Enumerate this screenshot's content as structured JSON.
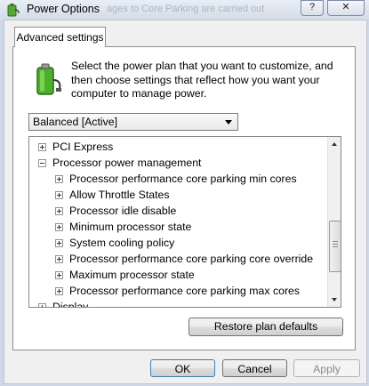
{
  "window": {
    "title": "Power Options",
    "background_caption": "ages to Core Parking are carried out",
    "help_label": "?",
    "close_label": "✕"
  },
  "tabs": [
    {
      "label": "Advanced settings"
    }
  ],
  "description": "Select the power plan that you want to customize, and then choose settings that reflect how you want your computer to manage power.",
  "plan_select": {
    "value": "Balanced [Active]"
  },
  "tree": {
    "items": [
      {
        "label": "PCI Express",
        "level": 0,
        "expander": "plus"
      },
      {
        "label": "Processor power management",
        "level": 0,
        "expander": "minus"
      },
      {
        "label": "Processor performance core parking min cores",
        "level": 1,
        "expander": "plus"
      },
      {
        "label": "Allow Throttle States",
        "level": 1,
        "expander": "plus"
      },
      {
        "label": "Processor idle disable",
        "level": 1,
        "expander": "plus"
      },
      {
        "label": "Minimum processor state",
        "level": 1,
        "expander": "plus"
      },
      {
        "label": "System cooling policy",
        "level": 1,
        "expander": "plus"
      },
      {
        "label": "Processor performance core parking core override",
        "level": 1,
        "expander": "plus"
      },
      {
        "label": "Maximum processor state",
        "level": 1,
        "expander": "plus"
      },
      {
        "label": "Processor performance core parking max cores",
        "level": 1,
        "expander": "plus"
      },
      {
        "label": "Display",
        "level": 0,
        "expander": "plus"
      }
    ]
  },
  "buttons": {
    "restore": "Restore plan defaults",
    "ok": "OK",
    "cancel": "Cancel",
    "apply": "Apply"
  },
  "icons": {
    "app": "power-options-icon",
    "battery": "battery-plug-icon"
  },
  "colors": {
    "accent": "#3c7fb1",
    "battery_green": "#4caf2a"
  }
}
